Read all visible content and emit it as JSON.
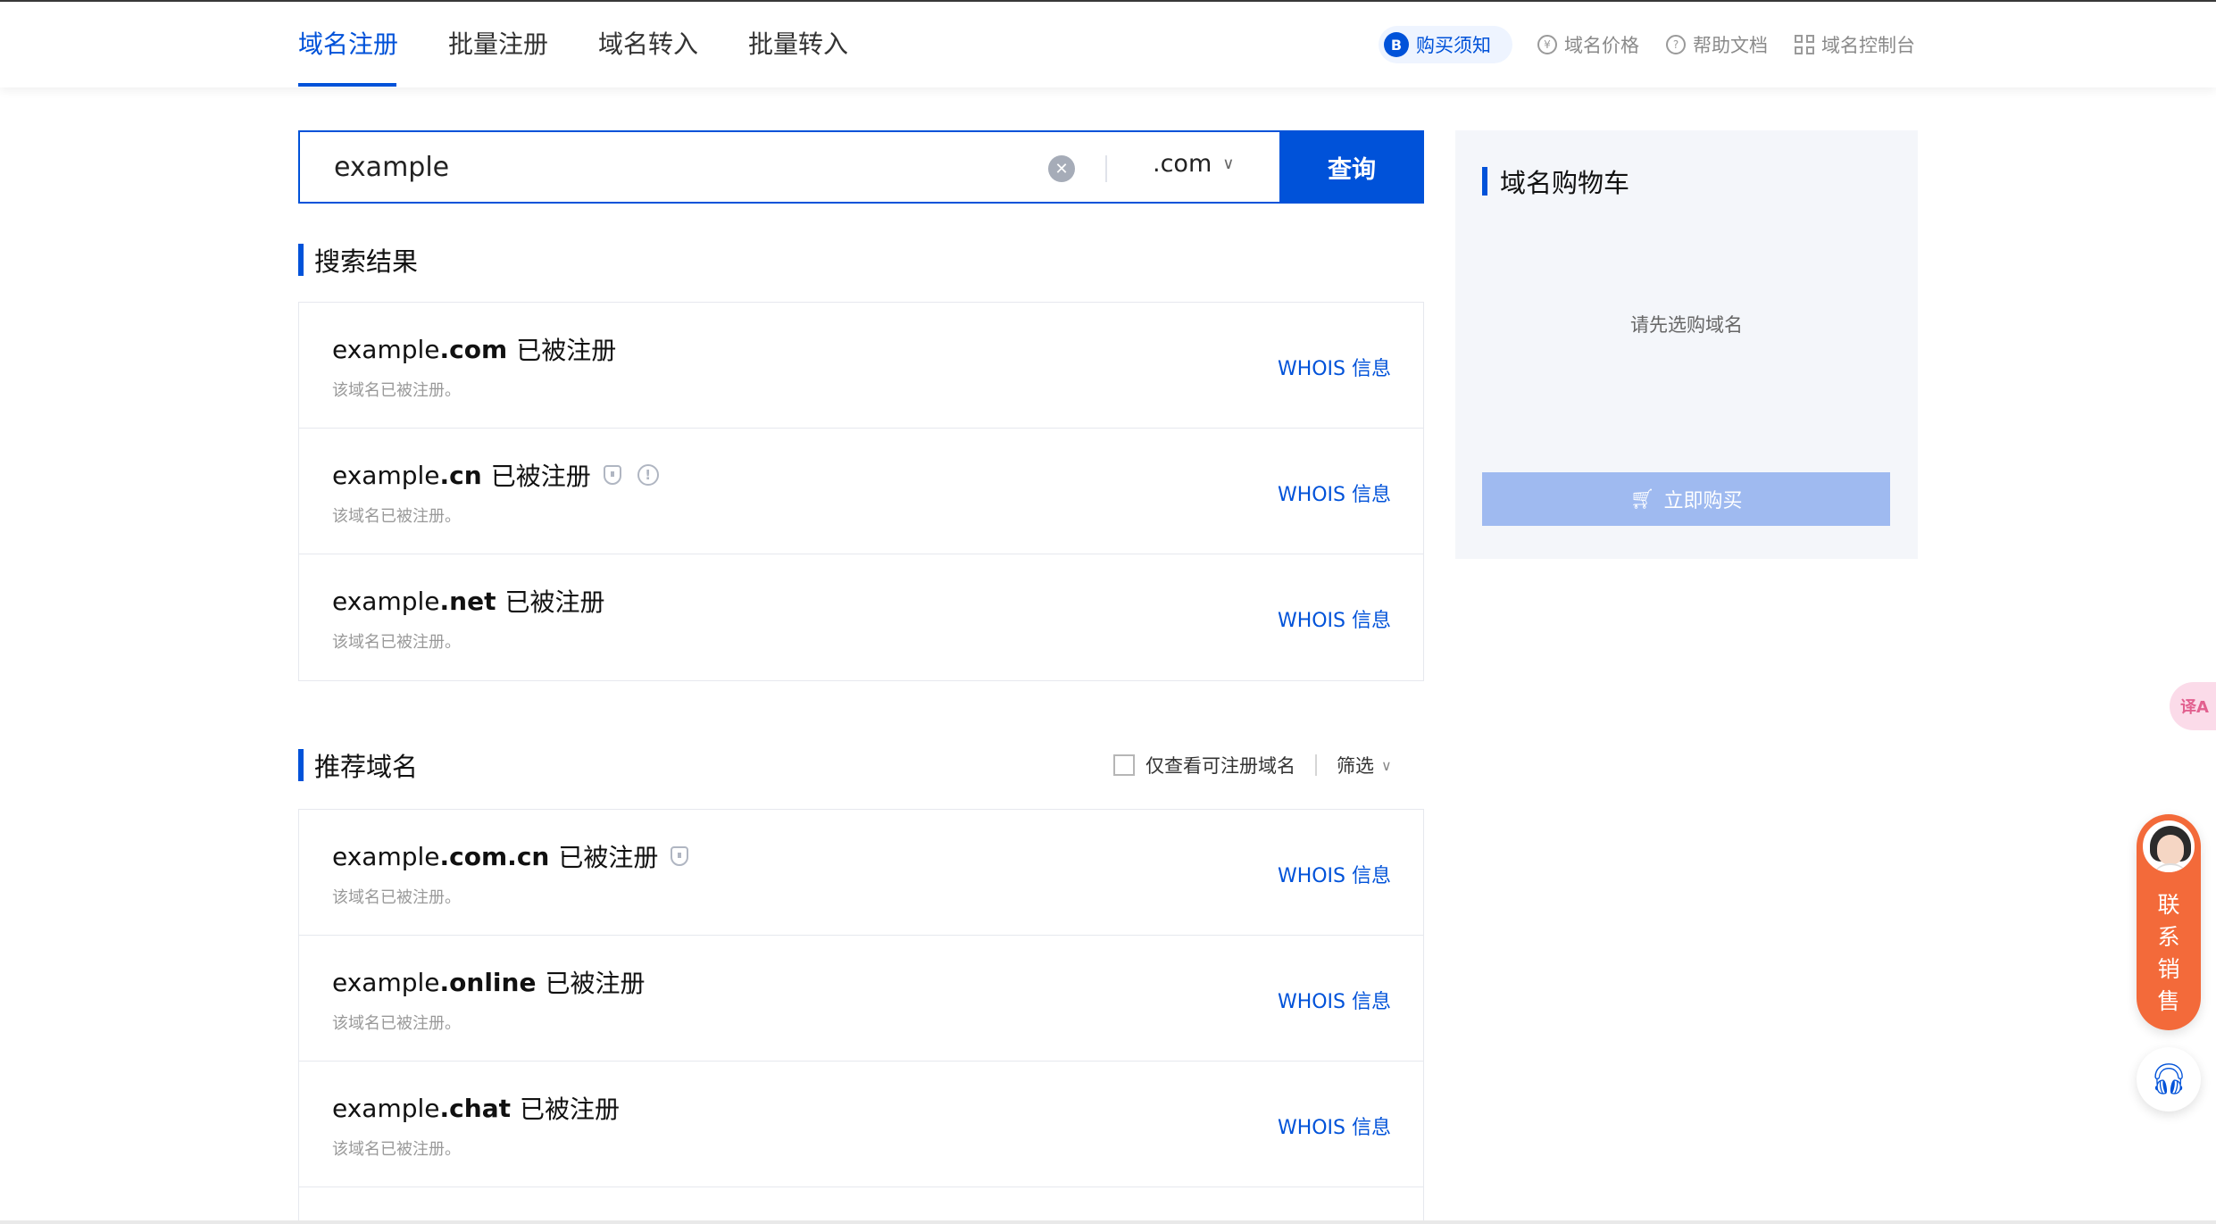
{
  "nav": {
    "tabs": [
      {
        "label": "域名注册",
        "active": true
      },
      {
        "label": "批量注册",
        "active": false
      },
      {
        "label": "域名转入",
        "active": false
      },
      {
        "label": "批量转入",
        "active": false
      }
    ],
    "notice": {
      "icon": "B",
      "label": "购买须知"
    },
    "links": [
      {
        "icon": "yen-icon",
        "glyph": "¥",
        "label": "域名价格"
      },
      {
        "icon": "question-icon",
        "glyph": "?",
        "label": "帮助文档"
      },
      {
        "icon": "grid-icon",
        "label": "域名控制台"
      }
    ]
  },
  "search": {
    "value": "example",
    "tld": ".com",
    "button": "查询"
  },
  "results": {
    "title": "搜索结果",
    "items": [
      {
        "name": "example",
        "ext": ".com",
        "status": "已被注册",
        "desc": "该域名已被注册。",
        "whois": "WHOIS 信息",
        "shield": false,
        "warn": false
      },
      {
        "name": "example",
        "ext": ".cn",
        "status": "已被注册",
        "desc": "该域名已被注册。",
        "whois": "WHOIS 信息",
        "shield": true,
        "warn": true
      },
      {
        "name": "example",
        "ext": ".net",
        "status": "已被注册",
        "desc": "该域名已被注册。",
        "whois": "WHOIS 信息",
        "shield": false,
        "warn": false
      }
    ]
  },
  "recommend": {
    "title": "推荐域名",
    "filter_label": "仅查看可注册域名",
    "filter_dropdown": "筛选",
    "items": [
      {
        "name": "example",
        "ext": ".com.cn",
        "status": "已被注册",
        "desc": "该域名已被注册。",
        "whois": "WHOIS 信息",
        "shield": true,
        "warn": false
      },
      {
        "name": "example",
        "ext": ".online",
        "status": "已被注册",
        "desc": "该域名已被注册。",
        "whois": "WHOIS 信息",
        "shield": false,
        "warn": false
      },
      {
        "name": "example",
        "ext": ".chat",
        "status": "已被注册",
        "desc": "该域名已被注册。",
        "whois": "WHOIS 信息",
        "shield": false,
        "warn": false
      }
    ]
  },
  "cart": {
    "title": "域名购物车",
    "empty_text": "请先选购域名",
    "buy_label": "立即购买"
  },
  "widgets": {
    "translate_glyph": "译A",
    "sales_text": "联系销售",
    "support_icon": "headset-icon"
  },
  "colors": {
    "accent": "#0052d9",
    "buy_disabled": "#9fbaf0",
    "sales": "#f36a3a"
  }
}
